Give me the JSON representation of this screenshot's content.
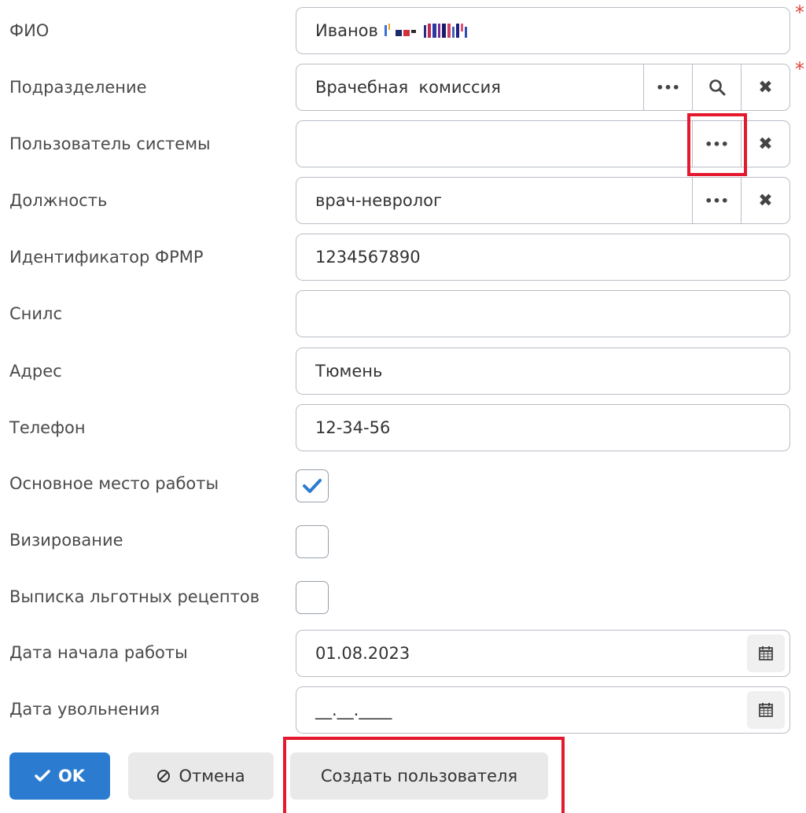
{
  "fields": {
    "fio": {
      "label": "ФИО",
      "value": "Иванов"
    },
    "department": {
      "label": "Подразделение",
      "value": "Врачебная  комиссия"
    },
    "system_user": {
      "label": "Пользователь системы",
      "value": ""
    },
    "position": {
      "label": "Должность",
      "value": "врач-невролог"
    },
    "frmr_id": {
      "label": "Идентификатор ФРМР",
      "value": "1234567890"
    },
    "snils": {
      "label": "Снилс",
      "value": ""
    },
    "address": {
      "label": "Адрес",
      "value": "Тюмень"
    },
    "phone": {
      "label": "Телефон",
      "value": "12-34-56"
    },
    "main_workplace": {
      "label": "Основное место работы",
      "checked": true
    },
    "visa": {
      "label": "Визирование",
      "checked": false
    },
    "preferential_prescriptions": {
      "label": "Выписка льготных рецептов",
      "checked": false
    },
    "start_date": {
      "label": "Дата начала работы",
      "value": "01.08.2023"
    },
    "dismissal_date": {
      "label": "Дата увольнения",
      "value": "__.__.____"
    }
  },
  "required_marker": "*",
  "buttons": {
    "ok": "OK",
    "cancel": "Отмена",
    "create_user": "Создать пользователя"
  },
  "colors": {
    "primary": "#2b7cd1",
    "required": "#e0463f",
    "highlight": "#e5192e",
    "border": "#b9bec6",
    "secondary_bg": "#e9e9e9"
  }
}
